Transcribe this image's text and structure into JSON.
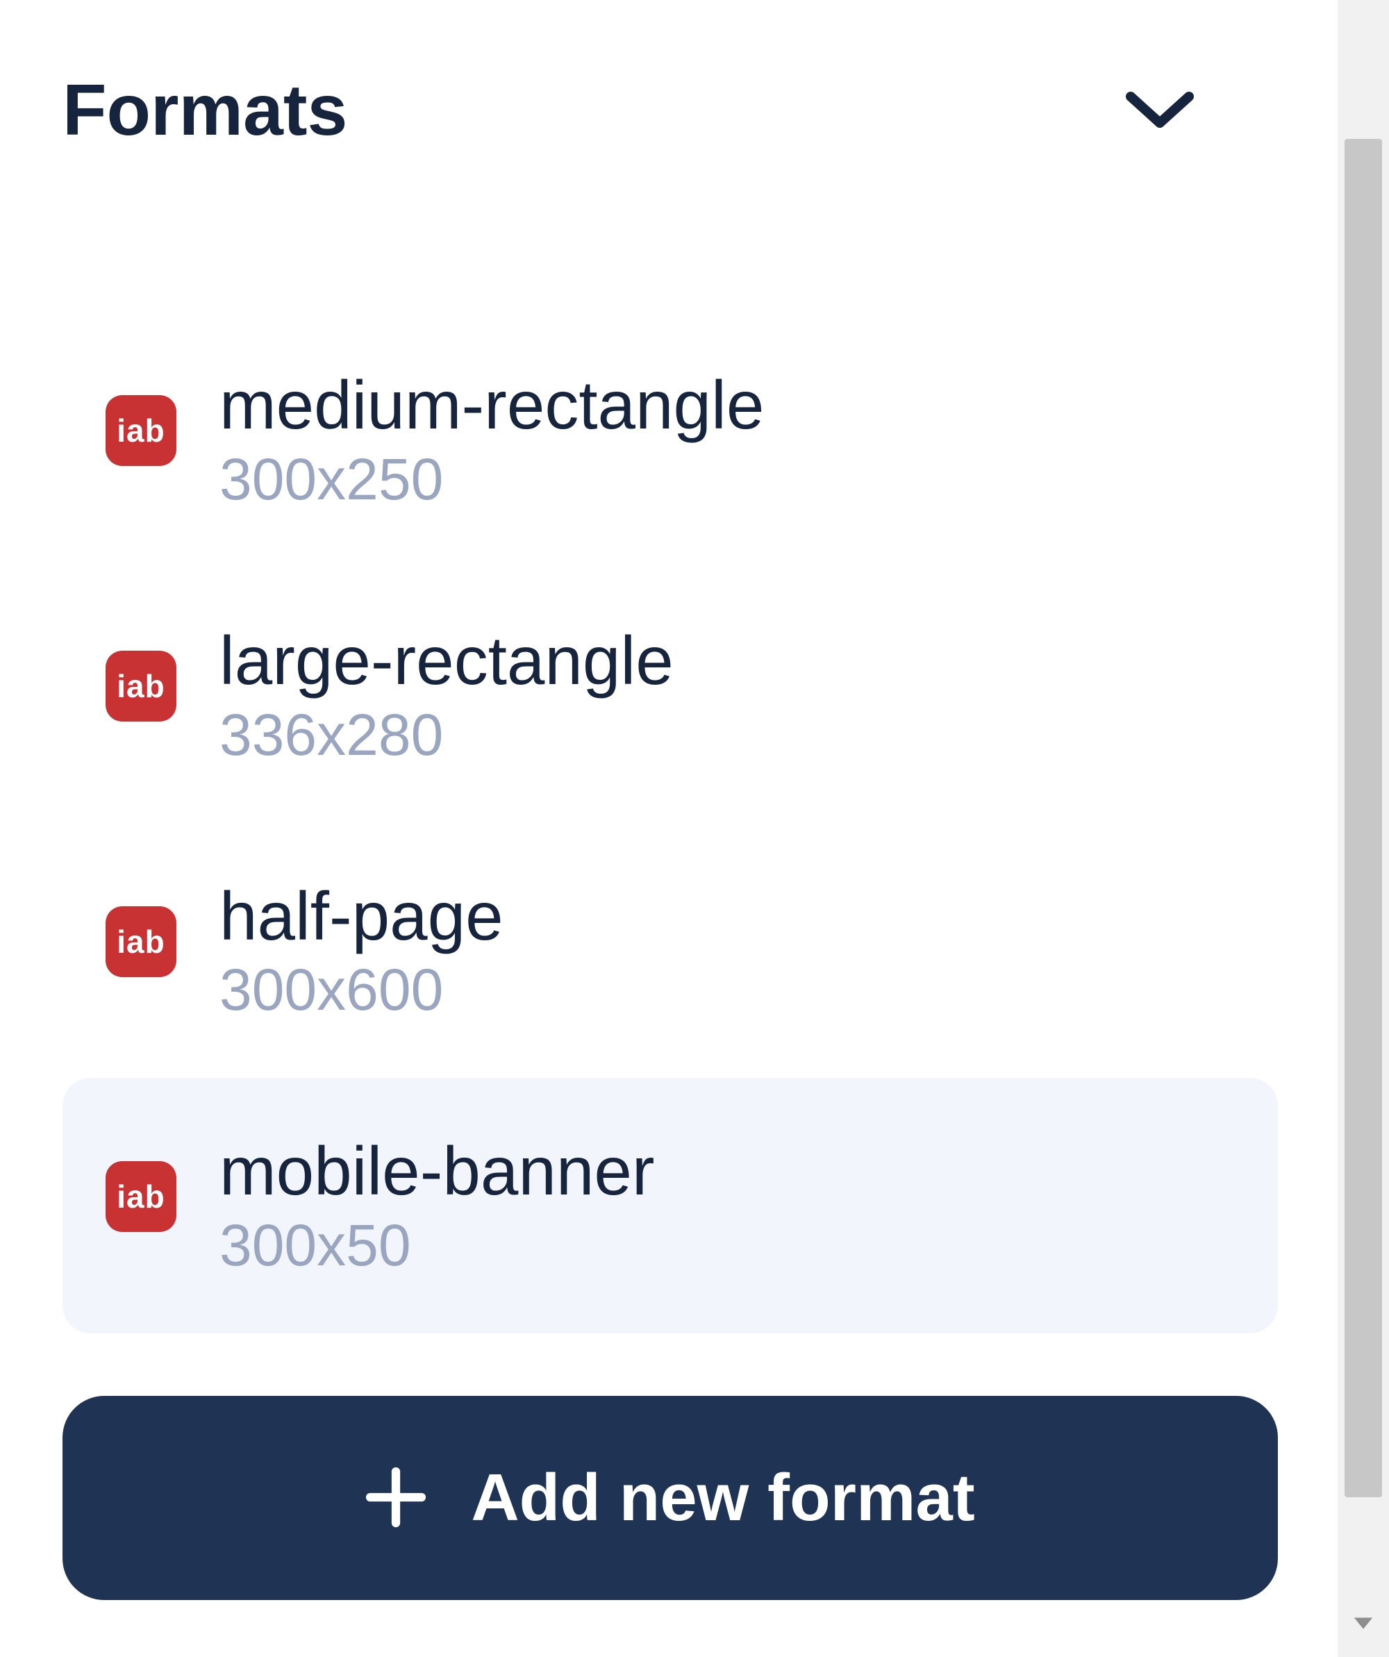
{
  "section": {
    "title": "Formats"
  },
  "formats": [
    {
      "badge": "iab",
      "name": "medium-rectangle",
      "dimensions": "300x250",
      "selected": false
    },
    {
      "badge": "iab",
      "name": "large-rectangle",
      "dimensions": "336x280",
      "selected": false
    },
    {
      "badge": "iab",
      "name": "half-page",
      "dimensions": "300x600",
      "selected": false
    },
    {
      "badge": "iab",
      "name": "mobile-banner",
      "dimensions": "300x50",
      "selected": true
    }
  ],
  "actions": {
    "add_new_format_label": "Add new format"
  }
}
